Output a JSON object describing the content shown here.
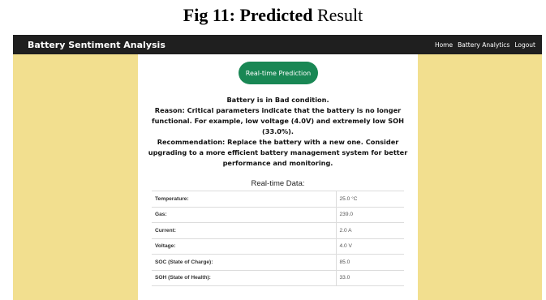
{
  "caption": {
    "prefix": "Fig 11: Predicted",
    "suffix": " Result"
  },
  "navbar": {
    "brand": "Battery Sentiment Analysis",
    "links": [
      "Home",
      "Battery Analytics",
      "Logout"
    ]
  },
  "prediction_button": "Real-time Prediction",
  "result": {
    "status": "Battery is in Bad condition.",
    "reason": "Reason: Critical parameters indicate that the battery is no longer functional. For example, low voltage (4.0V) and extremely low SOH (33.0%).",
    "recommendation": "Recommendation: Replace the battery with a new one. Consider upgrading to a more efficient battery management system for better performance and monitoring."
  },
  "realtime": {
    "title": "Real-time Data:",
    "rows": [
      {
        "label": "Temperature:",
        "value": "25.0 °C"
      },
      {
        "label": "Gas:",
        "value": "239.0"
      },
      {
        "label": "Current:",
        "value": "2.0 A"
      },
      {
        "label": "Voltage:",
        "value": "4.0 V"
      },
      {
        "label": "SOC (State of Charge):",
        "value": "85.0"
      },
      {
        "label": "SOH (State of Health):",
        "value": "33.0"
      }
    ]
  },
  "colors": {
    "navbar": "#1f1f1f",
    "background": "#f2df8f",
    "button": "#198754"
  }
}
